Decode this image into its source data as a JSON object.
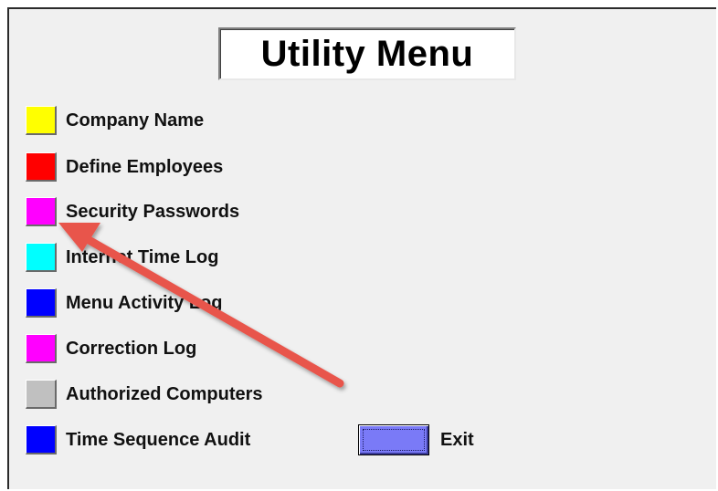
{
  "title": "Utility Menu",
  "menu": {
    "items": [
      {
        "label": "Company Name",
        "color": "#ffff00"
      },
      {
        "label": "Define Employees",
        "color": "#ff0000"
      },
      {
        "label": "Security Passwords",
        "color": "#ff00ff"
      },
      {
        "label": "Internet Time Log",
        "color": "#00ffff"
      },
      {
        "label": "Menu Activity Log",
        "color": "#0000ff"
      },
      {
        "label": "Correction Log",
        "color": "#ff00ff"
      },
      {
        "label": "Authorized Computers",
        "color": "#c0c0c0"
      },
      {
        "label": "Time Sequence Audit",
        "color": "#0000ff"
      }
    ]
  },
  "exit": {
    "label": "Exit",
    "color": "#7a7af7"
  },
  "annotation": {
    "arrow_color": "#e8554c",
    "icon": "red-arrow-icon"
  }
}
